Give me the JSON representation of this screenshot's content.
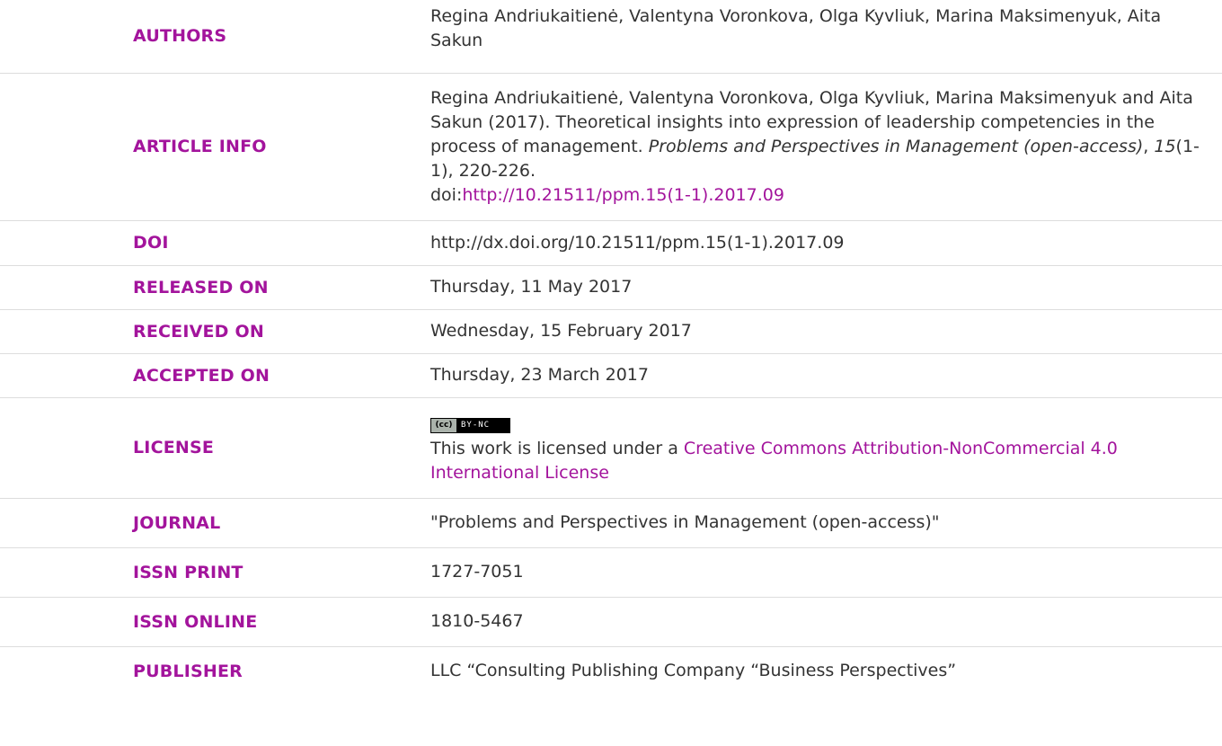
{
  "rows": {
    "authors": {
      "label": "AUTHORS",
      "value": "Regina Andriukaitienė, Valentyna Voronkova, Olga Kyvliuk, Marina Maksimenyuk, Aita Sakun"
    },
    "article_info": {
      "label": "ARTICLE INFO",
      "text_before": "Regina Andriukaitienė, Valentyna Voronkova, Olga Kyvliuk, Marina Maksimenyuk and Aita Sakun (2017). Theoretical insights into expression of leadership competencies in the process of management. ",
      "journal_italic": "Problems and Perspectives in Management (open-access)",
      "comma1": ", ",
      "volume_italic": "15",
      "issue_pages": "(1-1), 220-226.",
      "doi_prefix": "doi:",
      "doi_link": "http://10.21511/ppm.15(1-1).2017.09"
    },
    "doi": {
      "label": "DOI",
      "value": "http://dx.doi.org/10.21511/ppm.15(1-1).2017.09"
    },
    "released_on": {
      "label": "RELEASED ON",
      "value": "Thursday, 11 May 2017"
    },
    "received_on": {
      "label": "RECEIVED ON",
      "value": "Wednesday, 15 February 2017"
    },
    "accepted_on": {
      "label": "ACCEPTED ON",
      "value": "Thursday, 23 March 2017"
    },
    "license": {
      "label": "LICENSE",
      "badge_cc": "(cc)",
      "badge_text": "BY-NC",
      "text": "This work is licensed under a ",
      "link": "Creative Commons Attribution-NonCommercial 4.0 International License"
    },
    "journal": {
      "label": "JOURNAL",
      "value": "\"Problems and Perspectives in Management (open-access)\""
    },
    "issn_print": {
      "label": "ISSN PRINT",
      "value": "1727-7051"
    },
    "issn_online": {
      "label": "ISSN ONLINE",
      "value": "1810-5467"
    },
    "publisher": {
      "label": "PUBLISHER",
      "value": "LLC “Consulting Publishing Company “Business Perspectives”"
    }
  },
  "colors": {
    "label": "#a3149c",
    "link": "#a3149c",
    "text": "#333333",
    "divider": "#dddddd"
  }
}
